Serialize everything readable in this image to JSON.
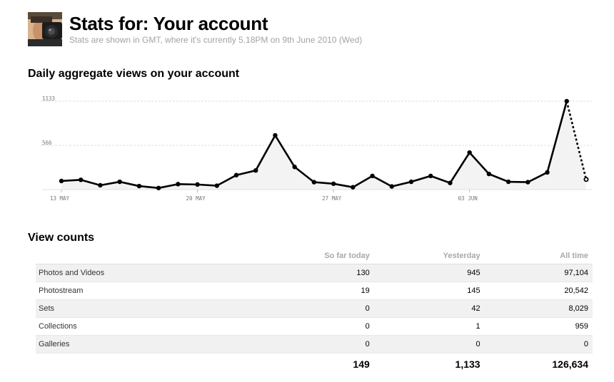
{
  "header": {
    "title": "Stats for: Your account",
    "subtitle": "Stats are shown in GMT, where it's currently 5.18PM on 9th June 2010 (Wed)"
  },
  "chart_section": {
    "title": "Daily aggregate views on your account"
  },
  "chart_data": {
    "type": "area",
    "title": "Daily aggregate views on your account",
    "xlabel": "",
    "ylabel": "",
    "x_tick_labels": [
      "13 MAY",
      "20 MAY",
      "27 MAY",
      "03 JUN"
    ],
    "y_ticks": [
      566,
      1133
    ],
    "ylim": [
      0,
      1133
    ],
    "grid": true,
    "series": [
      {
        "values": [
          110,
          125,
          55,
          100,
          45,
          20,
          70,
          65,
          50,
          185,
          245,
          695,
          290,
          95,
          75,
          30,
          175,
          40,
          100,
          175,
          85,
          475,
          200,
          100,
          95,
          220,
          1133,
          130
        ],
        "dashed_last_segment": true
      }
    ],
    "colors": {
      "line": "#000000",
      "fill": "#f3f3f3",
      "grid": "#dddddd"
    }
  },
  "counts_section": {
    "title": "View counts"
  },
  "counts_table": {
    "columns": [
      "So far today",
      "Yesterday",
      "All time"
    ],
    "rows": [
      {
        "label": "Photos and Videos",
        "today": "130",
        "yesterday": "945",
        "all_time": "97,104"
      },
      {
        "label": "Photostream",
        "today": "19",
        "yesterday": "145",
        "all_time": "20,542"
      },
      {
        "label": "Sets",
        "today": "0",
        "yesterday": "42",
        "all_time": "8,029"
      },
      {
        "label": "Collections",
        "today": "0",
        "yesterday": "1",
        "all_time": "959"
      },
      {
        "label": "Galleries",
        "today": "0",
        "yesterday": "0",
        "all_time": "0"
      }
    ],
    "totals": {
      "today": "149",
      "yesterday": "1,133",
      "all_time": "126,634"
    }
  }
}
